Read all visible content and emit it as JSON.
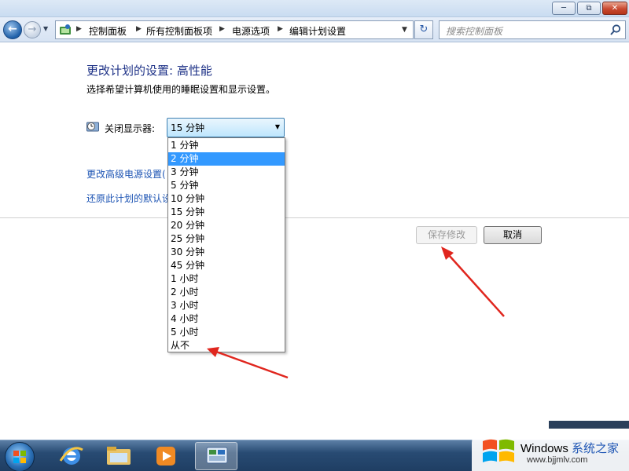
{
  "titlebar": {
    "minimize_icon": "minimize-icon",
    "maximize_icon": "restore-icon",
    "close_icon": "close-icon"
  },
  "navigation": {
    "breadcrumbs": [
      "控制面板",
      "所有控制面板项",
      "电源选项",
      "编辑计划设置"
    ],
    "search_placeholder": "搜索控制面板"
  },
  "main": {
    "title": "更改计划的设置: 高性能",
    "subtitle": "选择希望计算机使用的睡眠设置和显示设置。",
    "display_label": "关闭显示器:",
    "display_value": "15 分钟",
    "link_advanced": "更改高级电源设置(",
    "link_restore": "还原此计划的默认设",
    "save_button": "保存修改",
    "cancel_button": "取消"
  },
  "dropdown": {
    "options": [
      "1 分钟",
      "2 分钟",
      "3 分钟",
      "5 分钟",
      "10 分钟",
      "15 分钟",
      "20 分钟",
      "25 分钟",
      "30 分钟",
      "45 分钟",
      "1 小时",
      "2 小时",
      "3 小时",
      "4 小时",
      "5 小时",
      "从不"
    ],
    "highlighted": "2 分钟"
  },
  "watermark": {
    "title_en": "Windows",
    "title_cn": "系统之家",
    "url": "www.bjjmlv.com"
  },
  "colors": {
    "link": "#1e55b4",
    "heading": "#1e3287",
    "highlight": "#3399ff",
    "annotation_arrow": "#e0261e"
  }
}
